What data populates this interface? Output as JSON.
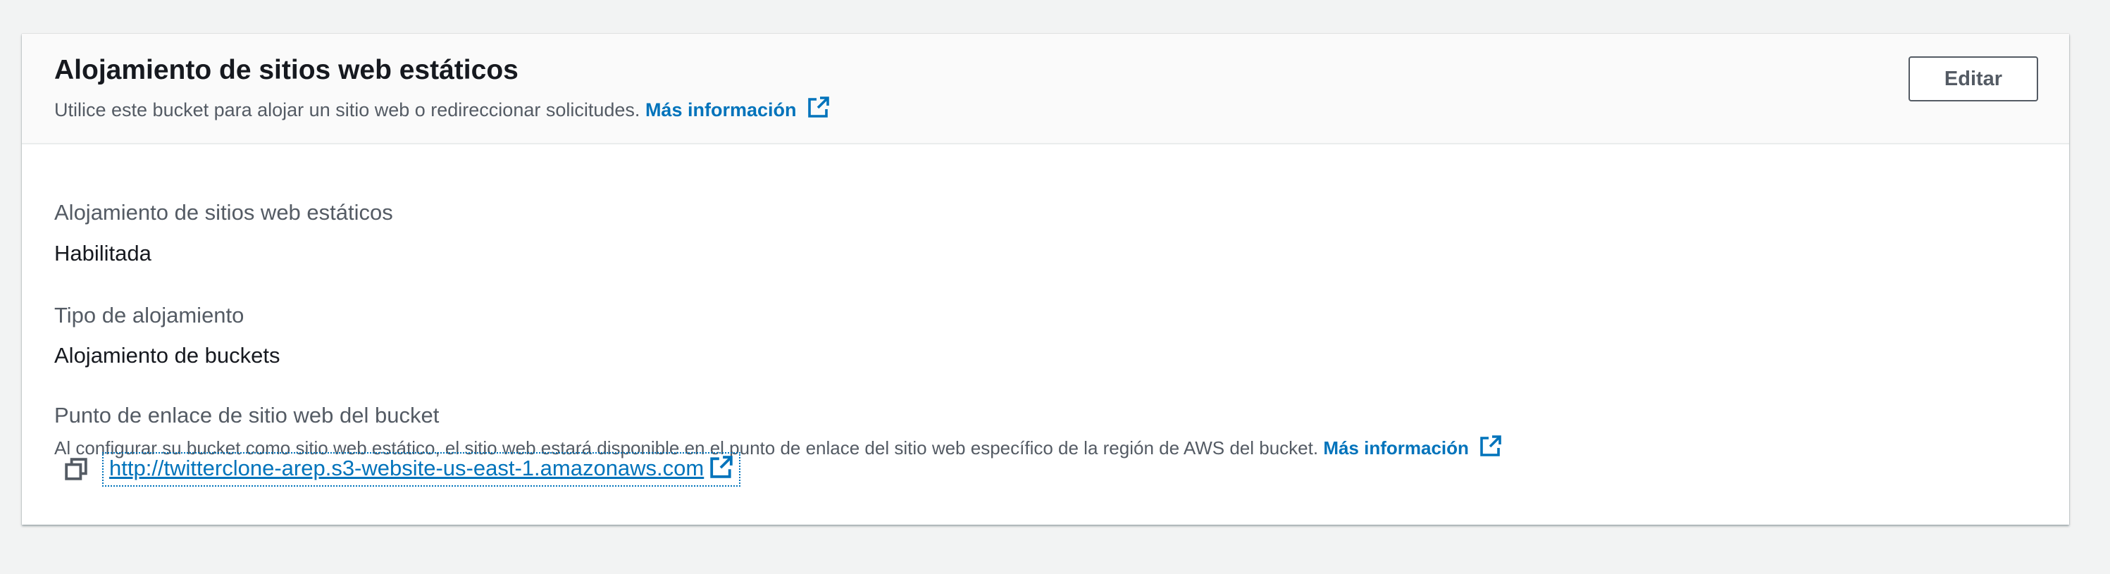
{
  "panel": {
    "title": "Alojamiento de sitios web estáticos",
    "description": "Utilice este bucket para alojar un sitio web o redireccionar solicitudes.",
    "learn_more": "Más información",
    "edit_label": "Editar"
  },
  "fields": {
    "hosting_label": "Alojamiento de sitios web estáticos",
    "hosting_value": "Habilitada",
    "type_label": "Tipo de alojamiento",
    "type_value": "Alojamiento de buckets",
    "endpoint_label": "Punto de enlace de sitio web del bucket",
    "endpoint_desc": "Al configurar su bucket como sitio web estático, el sitio web estará disponible en el punto de enlace del sitio web específico de la región de AWS del bucket.",
    "endpoint_learn_more": "Más información",
    "endpoint_url": "http://twitterclone-arep.s3-website-us-east-1.amazonaws.com"
  },
  "icons": {
    "external": "external-link-icon",
    "copy": "copy-icon"
  },
  "colors": {
    "link": "#0073bb",
    "page_bg": "#f2f3f3",
    "header_bg": "#fafafa"
  }
}
